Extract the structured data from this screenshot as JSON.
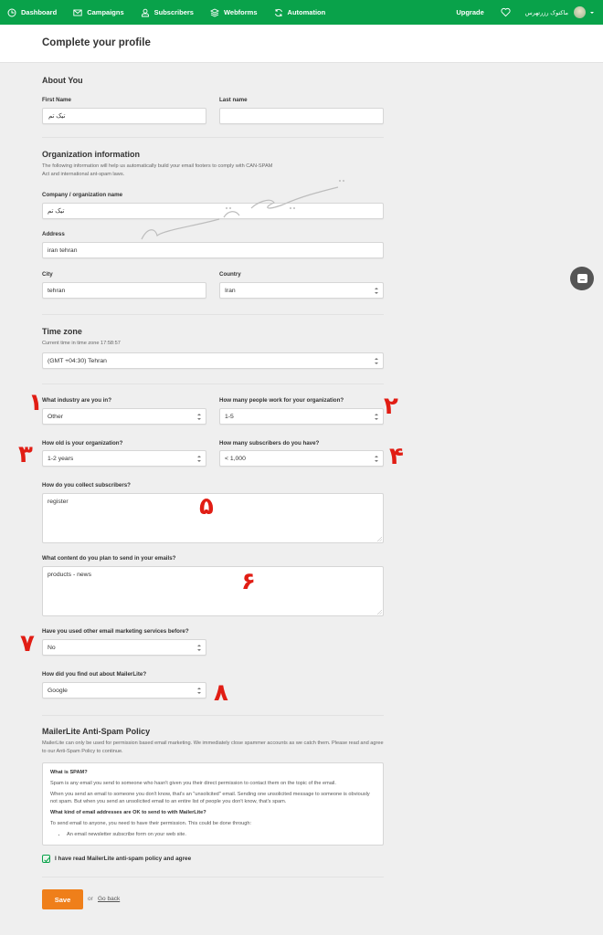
{
  "nav": {
    "items": [
      {
        "label": "Dashboard",
        "icon": "dashboard-clock-icon"
      },
      {
        "label": "Campaigns",
        "icon": "envelope-icon"
      },
      {
        "label": "Subscribers",
        "icon": "user-icon"
      },
      {
        "label": "Webforms",
        "icon": "layers-icon"
      },
      {
        "label": "Automation",
        "icon": "refresh-icon"
      }
    ],
    "upgrade": "Upgrade",
    "username": "ماکتوک رزرتهرس",
    "brand_color": "#09a24a"
  },
  "page": {
    "title": "Complete your profile"
  },
  "about": {
    "title": "About You",
    "first_name_label": "First Name",
    "first_name_value": "تیک تم",
    "last_name_label": "Last name",
    "last_name_value": ""
  },
  "org": {
    "title": "Organization information",
    "help": "The following information will help us automatically build your email footers to comply with CAN-SPAM Act and international ant-spam laws.",
    "company_label": "Company / organization name",
    "company_value": "تیک تم",
    "address_label": "Address",
    "address_value": "iran tehran",
    "city_label": "City",
    "city_value": "tehran",
    "country_label": "Country",
    "country_value": "Iran"
  },
  "timezone": {
    "title": "Time zone",
    "current": "Current time in time zone 17:58:57",
    "value": "(GMT +04:30) Tehran"
  },
  "questions": {
    "industry_label": "What industry are you in?",
    "industry_value": "Other",
    "people_label": "How many people work for your organization?",
    "people_value": "1-5",
    "age_label": "How old is your organization?",
    "age_value": "1-2 years",
    "subscribers_label": "How many subscribers do you have?",
    "subscribers_value": "< 1,000",
    "collect_label": "How do you collect subscribers?",
    "collect_value": "register",
    "content_label": "What content do you plan to send in your emails?",
    "content_value": "products - news",
    "used_label": "Have you used other email marketing services before?",
    "used_value": "No",
    "found_label": "How did you find out about MailerLite?",
    "found_value": "Google"
  },
  "markers": [
    "١",
    "٢",
    "٣",
    "۴",
    "۵",
    "۶",
    "٧",
    "٨"
  ],
  "watermark": "تیک تم",
  "policy": {
    "title": "MailerLite Anti-Spam Policy",
    "intro": "MailerLite can only be used for permission based email marketing. We immediately close spammer accounts as we catch them. Please read and agree to our Anti-Spam Policy to continue.",
    "h1": "What is SPAM?",
    "p1": "Spam is any email you send to someone who hasn't given you their direct permission to contact them on the topic of the email.",
    "p2": "When you send an email to someone you don't know, that's an \"unsolicited\" email. Sending one unsolicited message to someone is obviously not spam. But when you send an unsolicited email to an entire list of people you don't know, that's spam.",
    "h2": "What kind of email addresses are OK to send to with MailerLite?",
    "p3": "To send email to anyone, you need to have their permission. This could be done through:",
    "li1": "An email newsletter subscribe form on your web site.",
    "agree_label": "I have read MailerLite anti-spam policy and agree",
    "agree_checked": true
  },
  "actions": {
    "save": "Save",
    "or": "or",
    "go_back": "Go back",
    "save_color": "#ef7f1a"
  }
}
